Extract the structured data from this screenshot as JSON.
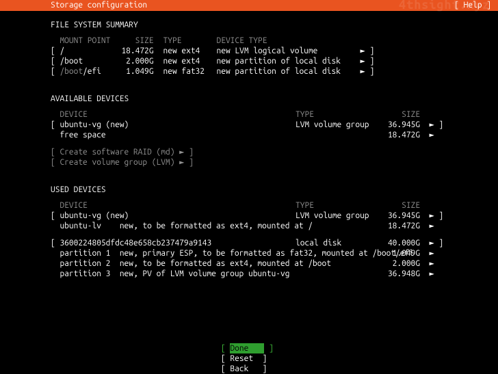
{
  "watermark": "4thsight.xyz",
  "header": {
    "title": "Storage configuration",
    "help": "[ Help ]"
  },
  "fss": {
    "title": "FILE SYSTEM SUMMARY",
    "cols": {
      "mount": "MOUNT POINT",
      "size": "SIZE",
      "type": "TYPE",
      "devtype": "DEVICE TYPE"
    },
    "rows": [
      {
        "lb": "[ ",
        "mount": "/",
        "mount_dim": "",
        "size": "18.472G",
        "type": "new ext4",
        "devtype": "new LVM logical volume",
        "tail": "► ]"
      },
      {
        "lb": "[ ",
        "mount": "/boot",
        "mount_dim": "",
        "size": "2.000G",
        "type": "new ext4",
        "devtype": "new partition of local disk",
        "tail": "► ]"
      },
      {
        "lb": "[ ",
        "mount": "",
        "mount_dim": "/boot",
        "mount_suffix": "/efi",
        "size": "1.049G",
        "type": "new fat32",
        "devtype": "new partition of local disk",
        "tail": "► ]"
      }
    ]
  },
  "avail": {
    "title": "AVAILABLE DEVICES",
    "cols": {
      "device": "DEVICE",
      "type": "TYPE",
      "size": "SIZE"
    },
    "rows": [
      {
        "lb": "[ ",
        "device": "ubuntu-vg (new)",
        "type": "LVM volume group",
        "size": "36.945G",
        "tail": "► ]"
      },
      {
        "lb": "  ",
        "device": "free space",
        "type": "",
        "size": "18.472G",
        "tail": "►"
      }
    ],
    "actions": {
      "raid": "[ Create software RAID (md) ► ]",
      "lvm": "[ Create volume group (LVM) ► ]"
    }
  },
  "used": {
    "title": "USED DEVICES",
    "cols": {
      "device": "DEVICE",
      "type": "TYPE",
      "size": "SIZE"
    },
    "rows": [
      {
        "lb": "[ ",
        "device": "ubuntu-vg (new)",
        "type": "LVM volume group",
        "size": "36.945G",
        "tail": "► ]"
      },
      {
        "lb": "  ",
        "device": "ubuntu-lv    new, to be formatted as ext4, mounted at /",
        "type": "",
        "size": "18.472G",
        "tail": "►"
      }
    ],
    "disk": {
      "head": {
        "lb": "[ ",
        "device": "3600224805dfdc48e658cb237479a9143",
        "type": "local disk",
        "size": "40.000G",
        "tail": "► ]"
      },
      "parts": [
        {
          "device": "partition 1  new, primary ESP, to be formatted as fat32, mounted at /boot/efi",
          "size": "1.049G",
          "tail": "►"
        },
        {
          "device": "partition 2  new, to be formatted as ext4, mounted at /boot",
          "size": "2.000G",
          "tail": "►"
        },
        {
          "device": "partition 3  new, PV of LVM volume group ubuntu-vg",
          "size": "36.948G",
          "tail": "►"
        }
      ]
    }
  },
  "footer": {
    "done": "Done",
    "reset": "Reset",
    "back": "Back"
  }
}
